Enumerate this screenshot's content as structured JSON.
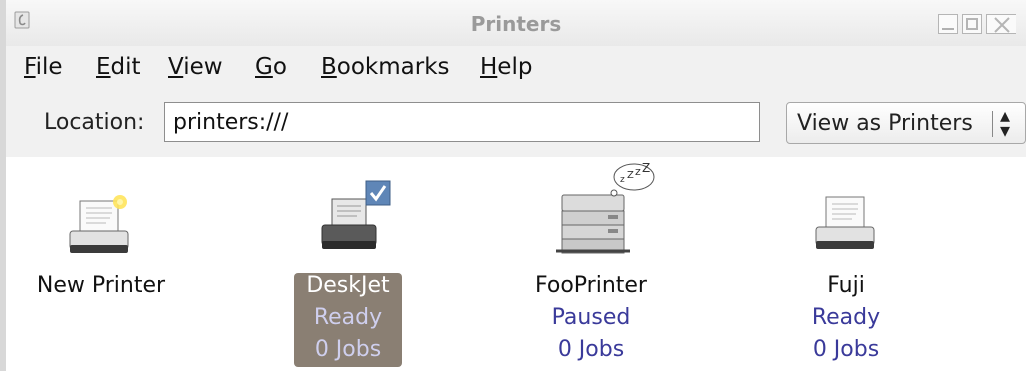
{
  "window": {
    "title": "Printers"
  },
  "menu": {
    "items": [
      {
        "label": "File",
        "mnemonic": "F",
        "rest": "ile"
      },
      {
        "label": "Edit",
        "mnemonic": "E",
        "rest": "dit"
      },
      {
        "label": "View",
        "mnemonic": "V",
        "rest": "iew"
      },
      {
        "label": "Go",
        "mnemonic": "G",
        "rest": "o"
      },
      {
        "label": "Bookmarks",
        "mnemonic": "B",
        "rest": "ookmarks"
      },
      {
        "label": "Help",
        "mnemonic": "H",
        "rest": "elp"
      }
    ]
  },
  "location": {
    "label": "Location:",
    "value": "printers:///",
    "view_as": "View as Printers"
  },
  "printers": [
    {
      "name": "New Printer",
      "status": "",
      "jobs": "",
      "icon": "new-printer-icon",
      "selected": false
    },
    {
      "name": "DeskJet",
      "status": "Ready",
      "jobs": "0 Jobs",
      "icon": "default-printer-icon",
      "selected": true
    },
    {
      "name": "FooPrinter",
      "status": "Paused",
      "jobs": "0 Jobs",
      "icon": "paused-printer-icon",
      "selected": false
    },
    {
      "name": "Fuji",
      "status": "Ready",
      "jobs": "0 Jobs",
      "icon": "printer-icon",
      "selected": false
    }
  ],
  "colors": {
    "status_text": "#3a3a9a",
    "selection": "#8a7f73"
  }
}
